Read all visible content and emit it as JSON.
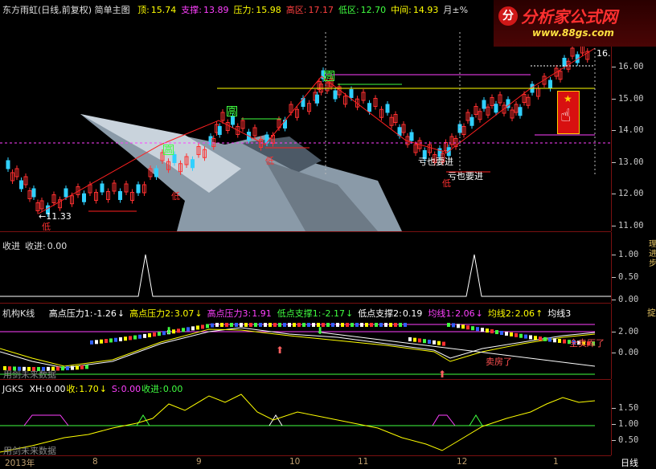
{
  "main": {
    "title": "东方雨虹(日线,前复权) 简单主图",
    "stats": [
      {
        "label": "顶:",
        "value": "15.74",
        "color": "#ffff00"
      },
      {
        "label": "支撑:",
        "value": "13.89",
        "color": "#ff40ff"
      },
      {
        "label": "压力:",
        "value": "15.98",
        "color": "#ffff00"
      },
      {
        "label": "高区:",
        "value": "17.17",
        "color": "#ff4040"
      },
      {
        "label": "低区:",
        "value": "12.70",
        "color": "#40ff40"
      },
      {
        "label": "中间:",
        "value": "14.93",
        "color": "#ffff00"
      },
      {
        "label": "月±%",
        "value": "",
        "color": "#e0e0e0"
      }
    ],
    "axis_ticks": [
      "16.00",
      "15.00",
      "14.00",
      "13.00",
      "12.00",
      "11.00"
    ],
    "last_price": "16.",
    "annotations": {
      "low_price": "←11.33",
      "low1": "低",
      "low2": "低",
      "low3": "低",
      "low4": "低",
      "high1": "高",
      "high2": "高",
      "high3": "高",
      "buy1": "亏也要进",
      "buy2": "亏也要进"
    }
  },
  "logo": {
    "mark": "分",
    "name": "分析家公式网",
    "url": "www.88gs.com"
  },
  "panel2": {
    "title": "收进",
    "label": "收进:",
    "value": "0.00",
    "axis_ticks": [
      "1.00",
      "0.50",
      "0.00"
    ],
    "side_text": "理进步"
  },
  "panel3": {
    "title": "机构K线",
    "items": [
      {
        "label": "高点压力1:",
        "value": "-1.26",
        "arrow": "↓",
        "color": "#ffffff"
      },
      {
        "label": "高点压力2:",
        "value": "3.07",
        "arrow": "↓",
        "color": "#ffff00"
      },
      {
        "label": "高点压力3:",
        "value": "1.91",
        "arrow": "",
        "color": "#ff40ff"
      },
      {
        "label": "低点支撑1:",
        "value": "-2.17",
        "arrow": "↓",
        "color": "#40ff40"
      },
      {
        "label": "低点支撑2:",
        "value": "0.19",
        "arrow": "",
        "color": "#ffffff"
      },
      {
        "label": "均线1:",
        "value": "2.06",
        "arrow": "↓",
        "color": "#ff40ff"
      },
      {
        "label": "均线2:",
        "value": "2.06",
        "arrow": "↑",
        "color": "#ffff00"
      },
      {
        "label": "均线3",
        "value": "",
        "arrow": "",
        "color": "#ffffff"
      }
    ],
    "axis_ticks": [
      "2.00",
      "0.00"
    ],
    "side_text": "掟",
    "watermark": "用剑未来数据",
    "annotations": {
      "sold": "全卖厍了",
      "bought": "卖房了"
    }
  },
  "panel4": {
    "title": "JGKS",
    "items": [
      {
        "label": "XH:",
        "value": "0.00",
        "color": "#ffffff"
      },
      {
        "label": "收:",
        "value": "1.70",
        "arrow": "↓",
        "color": "#ffff00"
      },
      {
        "label": "S:",
        "value": "0.00",
        "color": "#ff40ff"
      },
      {
        "label": "收进:",
        "value": "0.00",
        "color": "#40ff40"
      }
    ],
    "axis_ticks": [
      "1.50",
      "1.00",
      "0.50"
    ],
    "watermark": "用剑未来数据"
  },
  "xaxis": {
    "labels": [
      "2013年",
      "8",
      "9",
      "10",
      "11",
      "12",
      "1"
    ],
    "period": "日线"
  }
}
